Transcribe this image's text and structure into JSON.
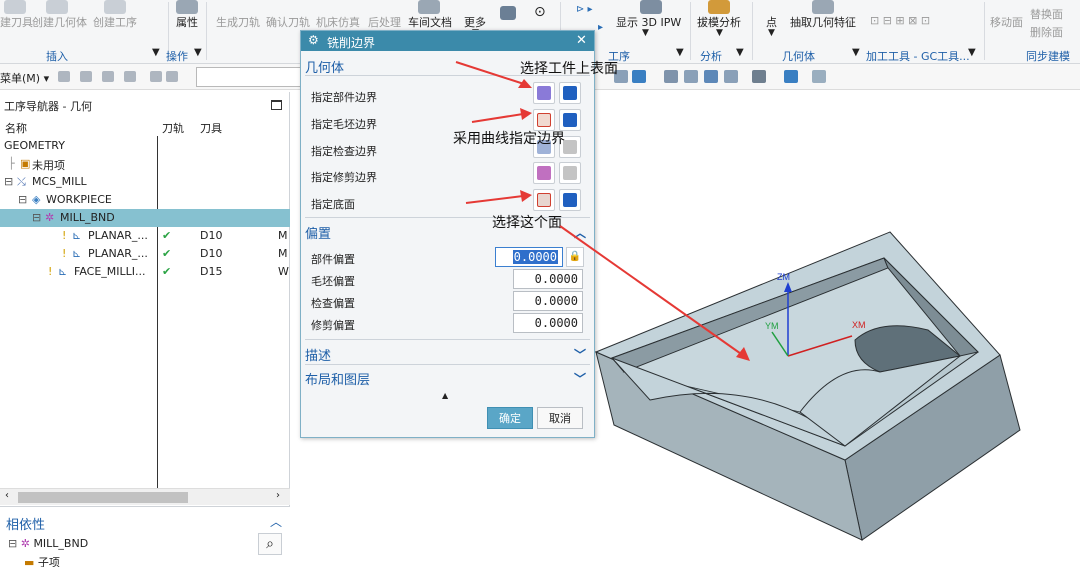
{
  "ribbon": {
    "items_faded": [
      "建刀具",
      "创建几何体",
      "创建工序",
      "生成刀轨",
      "确认刀轨",
      "机床仿真",
      "后处理",
      "移动面",
      "替换面",
      "删除面"
    ],
    "items": {
      "attributes": "属性",
      "shop_doc": "车间文档",
      "more": "更多",
      "display_3d_ipw": "显示 3D IPW",
      "draft_analysis": "拔模分析",
      "point": "点",
      "extract_geometry": "抽取几何特征"
    },
    "groups": {
      "insert": "插入",
      "operation": "操作",
      "process": "工序",
      "analysis": "分析",
      "geometry": "几何体",
      "gc_tools": "加工工具 - GC工具...",
      "sync_modeling": "同步建模"
    }
  },
  "toolbar2": {
    "menu_label": "菜单(M)"
  },
  "navigator": {
    "title": "工序导航器 - 几何",
    "columns": [
      "名称",
      "刀轨",
      "刀具"
    ],
    "rows": [
      {
        "name": "GEOMETRY",
        "toolpath": "",
        "tool": "",
        "extra": ""
      },
      {
        "name": "未用项",
        "toolpath": "",
        "tool": "",
        "extra": ""
      },
      {
        "name": "MCS_MILL",
        "toolpath": "",
        "tool": "",
        "extra": ""
      },
      {
        "name": "WORKPIECE",
        "toolpath": "",
        "tool": "",
        "extra": ""
      },
      {
        "name": "MILL_BND",
        "toolpath": "",
        "tool": "",
        "extra": ""
      },
      {
        "name": "PLANAR_...",
        "toolpath": "✔",
        "tool": "D10",
        "extra": "M"
      },
      {
        "name": "PLANAR_...",
        "toolpath": "✔",
        "tool": "D10",
        "extra": "M"
      },
      {
        "name": "FACE_MILLI...",
        "toolpath": "✔",
        "tool": "D15",
        "extra": "W"
      }
    ],
    "dependencies": {
      "title": "相依性",
      "items": [
        "MILL_BND",
        "子项"
      ]
    }
  },
  "dialog": {
    "title": "铣削边界",
    "geometry_section": "几何体",
    "geometry_rows": [
      "指定部件边界",
      "指定毛坯边界",
      "指定检查边界",
      "指定修剪边界",
      "指定底面"
    ],
    "offset_section": "偏置",
    "offset_rows": [
      {
        "label": "部件偏置",
        "value": "0.0000"
      },
      {
        "label": "毛坯偏置",
        "value": "0.0000"
      },
      {
        "label": "检查偏置",
        "value": "0.0000"
      },
      {
        "label": "修剪偏置",
        "value": "0.0000"
      }
    ],
    "description_section": "描述",
    "layout_section": "布局和图层",
    "ok": "确定",
    "cancel": "取消"
  },
  "annotations": {
    "select_top": "选择工件上表面",
    "curve_boundary": "采用曲线指定边界",
    "select_face": "选择这个面"
  },
  "viewport": {
    "axis_zm": "ZM",
    "axis_ym": "YM",
    "axis_xm": "XM"
  },
  "colors": {
    "dialog_title": "#3b8aaa",
    "section_text": "#1e5fa8",
    "selected_row": "#86c1d0",
    "part_face": "#c3d3da",
    "arrow": "#e53935"
  }
}
